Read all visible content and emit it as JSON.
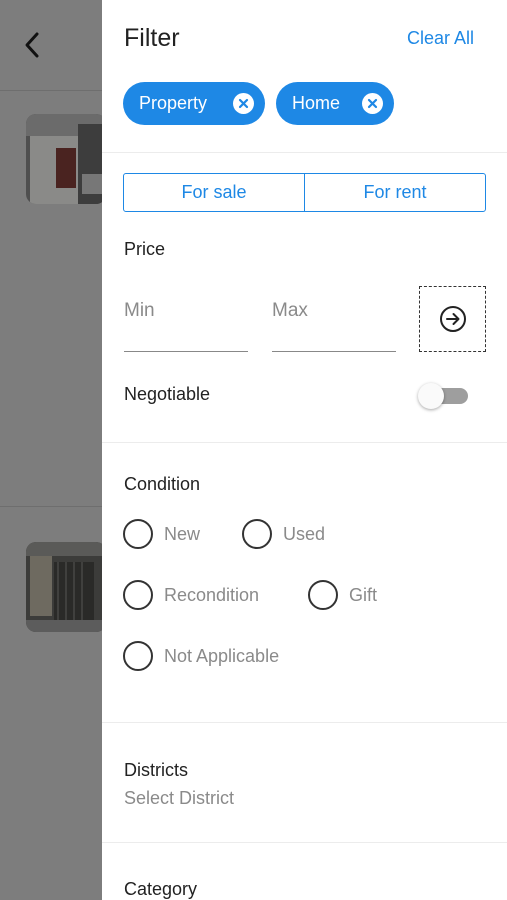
{
  "background": {
    "back_icon": "chevron-left-icon"
  },
  "drawer": {
    "title": "Filter",
    "clear_all": "Clear All",
    "chips": [
      {
        "label": "Property",
        "icon": "close-circle-icon"
      },
      {
        "label": "Home",
        "icon": "close-circle-icon"
      }
    ],
    "segments": [
      "For sale",
      "For rent"
    ],
    "price": {
      "label": "Price",
      "min_placeholder": "Min",
      "max_placeholder": "Max",
      "submit_icon": "arrow-right-circle-icon"
    },
    "negotiable": {
      "label": "Negotiable",
      "enabled": false
    },
    "condition": {
      "label": "Condition",
      "options": [
        "New",
        "Used",
        "Recondition",
        "Gift",
        "Not Applicable"
      ]
    },
    "districts": {
      "label": "Districts",
      "value": "Select District"
    },
    "category": {
      "label": "Category"
    }
  },
  "colors": {
    "accent": "#1e88e5",
    "overlay": "#7d7d7d"
  }
}
